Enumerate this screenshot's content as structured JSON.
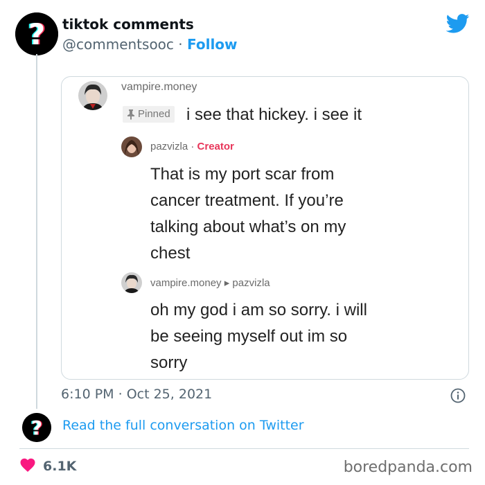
{
  "author": {
    "display_name": "tiktok comments",
    "username": "@commentsooc",
    "separator": "·",
    "follow_label": "Follow",
    "avatar_glyph": "?"
  },
  "icons": {
    "twitter": "twitter-bird-icon",
    "info": "info-icon",
    "heart": "heart-icon",
    "pin": "pin-icon"
  },
  "embed": {
    "comment1": {
      "username": "vampire.money",
      "pinned_label": "Pinned",
      "text": "i see that hickey. i see it"
    },
    "reply1": {
      "username": "pazvizla",
      "separator": "·",
      "badge": "Creator",
      "lines": [
        "That is my port scar from",
        "cancer treatment. If you’re",
        "talking about what’s on my",
        "chest"
      ]
    },
    "reply2": {
      "username": "vampire.money",
      "arrow": "▸",
      "reply_to": "pazvizla",
      "lines": [
        "oh my god i am so sorry. i will",
        "be seeing myself out im so",
        "sorry"
      ]
    }
  },
  "meta": {
    "time": "6:10 PM",
    "separator": "·",
    "date": "Oct 25, 2021"
  },
  "read_full": "Read the full conversation on Twitter",
  "likes": "6.1K",
  "watermark": "boredpanda.com",
  "colors": {
    "twitter_blue": "#1d9bf0",
    "heart": "#f91880",
    "creator": "#e8365a",
    "tiktok_cyan": "#25f4ee",
    "tiktok_red": "#fe2c55"
  }
}
